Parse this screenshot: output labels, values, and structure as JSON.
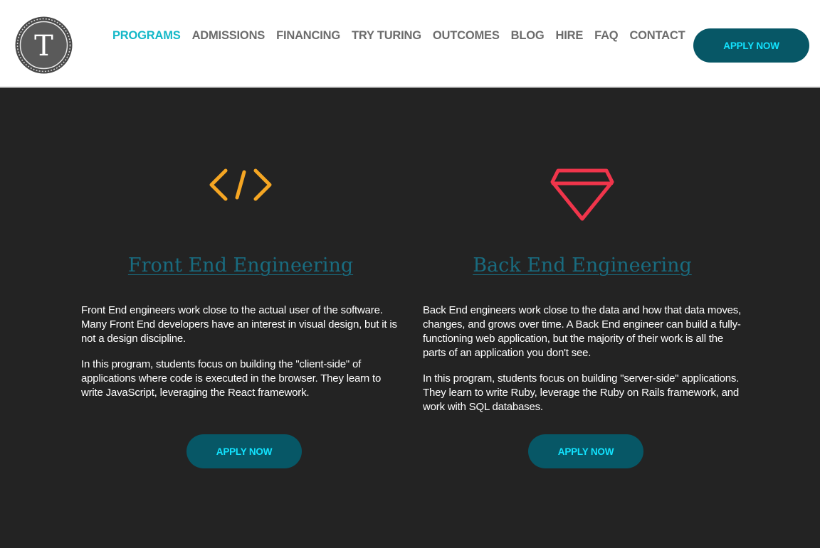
{
  "header": {
    "logo_letter": "T",
    "nav": [
      {
        "label": "PROGRAMS",
        "active": true
      },
      {
        "label": "ADMISSIONS"
      },
      {
        "label": "FINANCING"
      },
      {
        "label": "TRY TURING"
      },
      {
        "label": "OUTCOMES"
      },
      {
        "label": "BLOG"
      },
      {
        "label": "HIRE"
      },
      {
        "label": "FAQ"
      },
      {
        "label": "CONTACT"
      }
    ],
    "apply_label": "APPLY NOW"
  },
  "programs": [
    {
      "icon": "code-icon",
      "title": "Front End Engineering",
      "paragraphs": [
        "Front End engineers work close to the actual user of the software. Many Front End developers have an interest in visual design, but it is not a design discipline.",
        "In this program, students focus on building the \"client-side\" of applications where code is executed in the browser. They learn to write JavaScript, leveraging the React framework."
      ],
      "apply_label": "APPLY NOW"
    },
    {
      "icon": "ruby-gem-icon",
      "title": "Back End Engineering",
      "paragraphs": [
        "Back End engineers work close to the data and how that data moves, changes, and grows over time. A Back End engineer can build a fully-functioning web application, but the majority of their work is all the parts of an application you don't see.",
        "In this program, students focus on building \"server-side\" applications. They learn to write Ruby, leverage the Ruby on Rails framework, and work with SQL databases."
      ],
      "apply_label": "APPLY NOW"
    }
  ],
  "colors": {
    "accent": "#14b8c8",
    "button_bg": "#075766",
    "button_text": "#12e3ff",
    "code_icon": "#f5a623",
    "gem_icon": "#f0354b",
    "title": "#196c80"
  }
}
